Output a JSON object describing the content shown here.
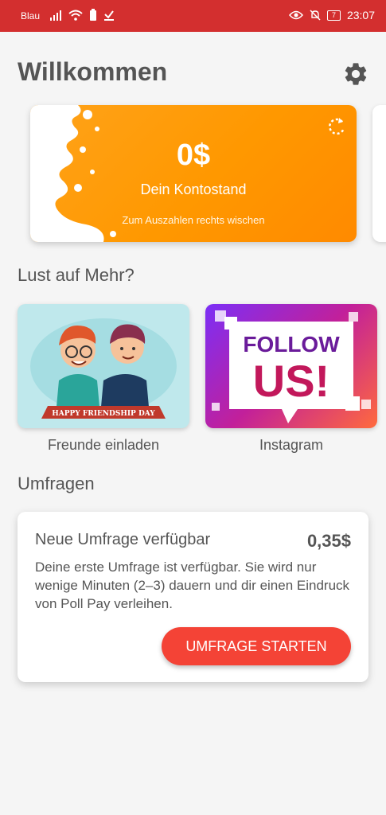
{
  "status_bar": {
    "carrier": "Blau",
    "battery": "7",
    "time": "23:07",
    "background": "#d32f2f",
    "left_icons": [
      "signal-icon",
      "wifi-icon",
      "battery-saver-icon",
      "download-done-icon"
    ],
    "right_icons": [
      "eye-icon",
      "mute-icon"
    ]
  },
  "header": {
    "title": "Willkommen",
    "settings_icon": "gear-icon"
  },
  "balance_card": {
    "amount": "0$",
    "label": "Dein Kontostand",
    "hint": "Zum Auszahlen rechts wischen",
    "refresh_icon": "refresh-icon",
    "color": "#ff9800"
  },
  "more_section": {
    "title": "Lust auf Mehr?",
    "tiles": [
      {
        "label": "Freunde einladen",
        "banner": "HAPPY FRIENDSHIP DAY"
      },
      {
        "label": "Instagram",
        "line1": "FOLLOW",
        "line2": "US!"
      }
    ]
  },
  "surveys_section": {
    "title": "Umfragen",
    "card": {
      "title": "Neue Umfrage verfügbar",
      "reward": "0,35$",
      "description": "Deine erste Umfrage ist verfügbar. Sie wird nur wenige Minuten (2–3) dauern und dir einen Eindruck von Poll Pay verleihen.",
      "button": "UMFRAGE STARTEN",
      "button_color": "#f44336"
    }
  }
}
